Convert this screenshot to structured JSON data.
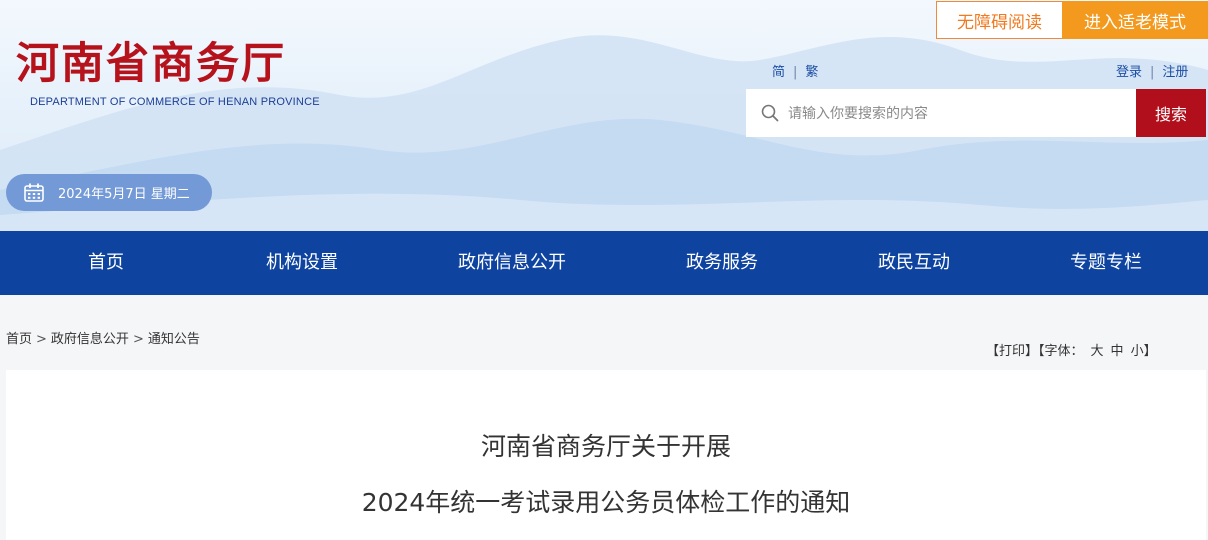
{
  "header": {
    "site_name": "河南省商务厅",
    "site_name_en": "DEPARTMENT OF COMMERCE OF HENAN PROVINCE",
    "accessibility_label": "无障碍阅读",
    "elder_mode_label": "进入适老模式",
    "lang_simplified": "简",
    "lang_traditional": "繁",
    "lang_separator": "|",
    "login_label": "登录",
    "register_label": "注册",
    "search": {
      "placeholder": "请输入你要搜索的内容",
      "button_label": "搜索"
    },
    "date_text": "2024年5月7日 星期二"
  },
  "nav": {
    "items": [
      "首页",
      "机构设置",
      "政府信息公开",
      "政务服务",
      "政民互动",
      "专题专栏"
    ]
  },
  "breadcrumb": {
    "items": [
      "首页",
      "政府信息公开",
      "通知公告"
    ],
    "separator": ">"
  },
  "tools": {
    "print_label": "【打印】",
    "font_prefix": "【字体：",
    "font_large": "大",
    "font_medium": "中",
    "font_small": "小",
    "font_suffix": "】"
  },
  "article": {
    "title_line1": "河南省商务厅关于开展",
    "title_line2": "2024年统一考试录用公务员体检工作的通知"
  },
  "colors": {
    "brand_red": "#b5121b",
    "nav_blue": "#0e44a0",
    "accent_orange": "#f39a1e",
    "search_red": "#b10f1c"
  },
  "icons": {
    "search": "search-icon",
    "calendar": "calendar-icon"
  }
}
